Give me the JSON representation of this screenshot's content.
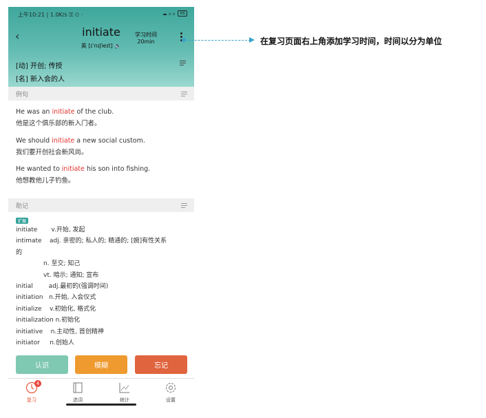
{
  "status": {
    "time": "上午10:21 | 1.0K/s ⚿ ⏲ ·",
    "signal": "☁ ᵢₗₗ ᵢₗₗ",
    "battery": "66"
  },
  "header": {
    "word": "initiate",
    "phonetic": "英 [ɪˈnɪʃieɪt] 🔈",
    "study_label": "学习时间",
    "study_value": "20min"
  },
  "meanings": [
    "[动] 开创; 传授",
    "[名] 新入会的人"
  ],
  "examples_section": {
    "title": "例句"
  },
  "examples": [
    {
      "pre": "He was an ",
      "hl": "initiate",
      "post": " of the club.",
      "cn": "他是这个俱乐部的新入门者。"
    },
    {
      "pre": "We should ",
      "hl": "initiate",
      "post": " a new social custom.",
      "cn": "我们要开创社会新风尚。"
    },
    {
      "pre": "He wanted to ",
      "hl": "initiate",
      "post": " his son into fishing.",
      "cn": "他想教他儿子钓鱼。"
    }
  ],
  "memo_section": {
    "title": "助记",
    "tag": "扩展"
  },
  "memo_lines": [
    "initiate       v.开始, 发起",
    "intimate    adj. 亲密的; 私人的; 精通的; [婉]有性关系",
    "的",
    "              n. 至交; 知己",
    "              vt. 暗示; 通知; 宣布",
    "initial        adj.最初的(强调时间)",
    "initiation   n.开始, 入会仪式",
    "initialize    v.初始化, 格式化",
    "initialization n.初始化",
    "initiative    n.主动性, 首创精神",
    "initiator     n.创始人"
  ],
  "buttons": {
    "know": "认识",
    "vague": "模糊",
    "forget": "忘记"
  },
  "tabs": [
    {
      "label": "复习",
      "icon": "review-clock-icon",
      "badge": "4"
    },
    {
      "label": "选词",
      "icon": "book-icon"
    },
    {
      "label": "统计",
      "icon": "chart-icon"
    },
    {
      "label": "设置",
      "icon": "gear-icon"
    }
  ],
  "annotation": {
    "text": "在复习页面右上角添加学习时间，时间以分为单位"
  },
  "colors": {
    "accent": "#3fa79c",
    "know": "#7fc8b1",
    "vague": "#ee9a2f",
    "forget": "#e0643d",
    "highlight": "#e0302c"
  }
}
